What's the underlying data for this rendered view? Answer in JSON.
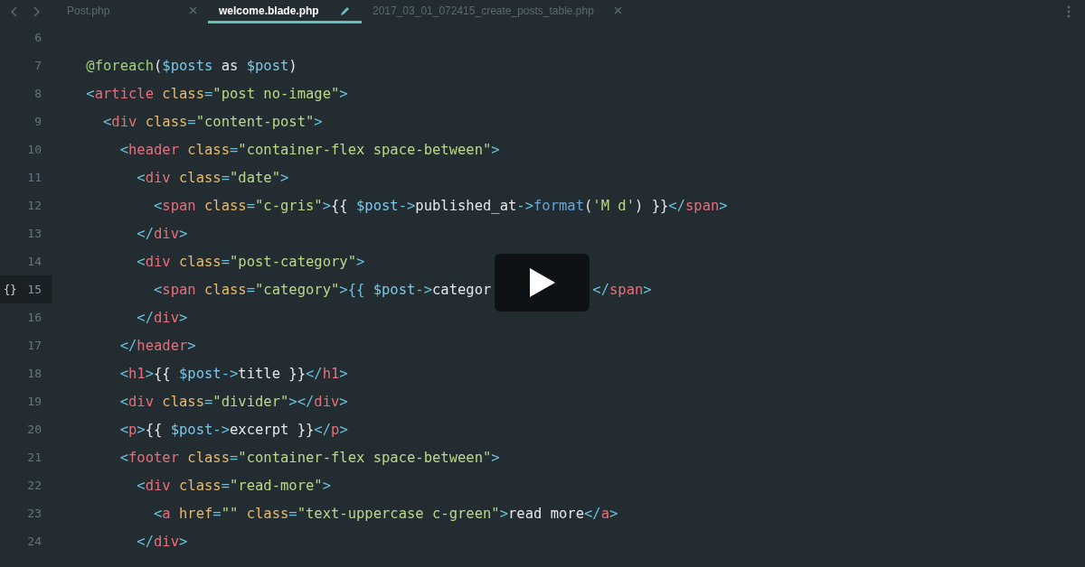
{
  "tabs": [
    {
      "label": "Post.php",
      "selected": false,
      "modified": false
    },
    {
      "label": "welcome.blade.php",
      "selected": true,
      "modified": true
    },
    {
      "label": "2017_03_01_072415_create_posts_table.php",
      "selected": false,
      "modified": false
    }
  ],
  "lines": [
    {
      "number": "6",
      "selected": false
    },
    {
      "number": "7",
      "selected": false,
      "tokens": [
        {
          "kind": "kw",
          "text": "    @foreach"
        },
        {
          "kind": "plain",
          "text": "("
        },
        {
          "kind": "var",
          "text": "$posts"
        },
        {
          "kind": "plain",
          "text": " as "
        },
        {
          "kind": "var",
          "text": "$post"
        },
        {
          "kind": "plain",
          "text": ")"
        }
      ]
    },
    {
      "number": "8",
      "selected": false,
      "tokens": [
        {
          "kind": "p",
          "text": "    <"
        },
        {
          "kind": "tag",
          "text": "article"
        },
        {
          "kind": "attr",
          "text": " class"
        },
        {
          "kind": "p",
          "text": "="
        },
        {
          "kind": "str",
          "text": "\"post no-image\""
        },
        {
          "kind": "p",
          "text": ">"
        }
      ]
    },
    {
      "number": "9",
      "selected": false,
      "tokens": [
        {
          "kind": "p",
          "text": "      <"
        },
        {
          "kind": "tag",
          "text": "div"
        },
        {
          "kind": "attr",
          "text": " class"
        },
        {
          "kind": "p",
          "text": "="
        },
        {
          "kind": "str",
          "text": "\"content-post\""
        },
        {
          "kind": "p",
          "text": ">"
        }
      ]
    },
    {
      "number": "10",
      "selected": false,
      "tokens": [
        {
          "kind": "p",
          "text": "        <"
        },
        {
          "kind": "tag",
          "text": "header"
        },
        {
          "kind": "attr",
          "text": " class"
        },
        {
          "kind": "p",
          "text": "="
        },
        {
          "kind": "str",
          "text": "\"container-flex space-between\""
        },
        {
          "kind": "p",
          "text": ">"
        }
      ]
    },
    {
      "number": "11",
      "selected": false,
      "tokens": [
        {
          "kind": "p",
          "text": "          <"
        },
        {
          "kind": "tag",
          "text": "div"
        },
        {
          "kind": "attr",
          "text": " class"
        },
        {
          "kind": "p",
          "text": "="
        },
        {
          "kind": "str",
          "text": "\"date\""
        },
        {
          "kind": "p",
          "text": ">"
        }
      ]
    },
    {
      "number": "12",
      "selected": false,
      "tokens": [
        {
          "kind": "p",
          "text": "            <"
        },
        {
          "kind": "tag",
          "text": "span"
        },
        {
          "kind": "attr",
          "text": " class"
        },
        {
          "kind": "p",
          "text": "="
        },
        {
          "kind": "str",
          "text": "\"c-gris\""
        },
        {
          "kind": "p",
          "text": ">"
        },
        {
          "kind": "plain",
          "text": "{{ "
        },
        {
          "kind": "var",
          "text": "$post"
        },
        {
          "kind": "p",
          "text": "->"
        },
        {
          "kind": "plain",
          "text": "published_at"
        },
        {
          "kind": "p",
          "text": "->"
        },
        {
          "kind": "func",
          "text": "format"
        },
        {
          "kind": "plain",
          "text": "("
        },
        {
          "kind": "str",
          "text": "'M d'"
        },
        {
          "kind": "plain",
          "text": ") }}"
        },
        {
          "kind": "p",
          "text": "</"
        },
        {
          "kind": "tag",
          "text": "span"
        },
        {
          "kind": "p",
          "text": ">"
        }
      ]
    },
    {
      "number": "13",
      "selected": false,
      "tokens": [
        {
          "kind": "p",
          "text": "          </"
        },
        {
          "kind": "tag",
          "text": "div"
        },
        {
          "kind": "p",
          "text": ">"
        }
      ]
    },
    {
      "number": "14",
      "selected": false,
      "tokens": [
        {
          "kind": "p",
          "text": "          <"
        },
        {
          "kind": "tag",
          "text": "div"
        },
        {
          "kind": "attr",
          "text": " class"
        },
        {
          "kind": "p",
          "text": "="
        },
        {
          "kind": "str",
          "text": "\"post-category\""
        },
        {
          "kind": "p",
          "text": ">"
        }
      ]
    },
    {
      "number": "15",
      "selected": true,
      "marker": "{}",
      "tokens": [
        {
          "kind": "p",
          "text": "            <"
        },
        {
          "kind": "tag",
          "text": "span"
        },
        {
          "kind": "attr",
          "text": " class"
        },
        {
          "kind": "p",
          "text": "="
        },
        {
          "kind": "str",
          "text": "\"category\""
        },
        {
          "kind": "p",
          "text": ">{{ "
        },
        {
          "kind": "var",
          "text": "$post"
        },
        {
          "kind": "p",
          "text": "->"
        },
        {
          "kind": "plain",
          "text": "categor"
        },
        {
          "kind": "covered"
        },
        {
          "kind": "p",
          "text": "</"
        },
        {
          "kind": "tag",
          "text": "span"
        },
        {
          "kind": "p",
          "text": ">"
        }
      ]
    },
    {
      "number": "16",
      "selected": false,
      "tokens": [
        {
          "kind": "p",
          "text": "          </"
        },
        {
          "kind": "tag",
          "text": "div"
        },
        {
          "kind": "p",
          "text": ">"
        }
      ]
    },
    {
      "number": "17",
      "selected": false,
      "tokens": [
        {
          "kind": "p",
          "text": "        </"
        },
        {
          "kind": "tag",
          "text": "header"
        },
        {
          "kind": "p",
          "text": ">"
        }
      ]
    },
    {
      "number": "18",
      "selected": false,
      "tokens": [
        {
          "kind": "p",
          "text": "        <"
        },
        {
          "kind": "tag",
          "text": "h1"
        },
        {
          "kind": "p",
          "text": ">"
        },
        {
          "kind": "plain",
          "text": "{{ "
        },
        {
          "kind": "var",
          "text": "$post"
        },
        {
          "kind": "p",
          "text": "->"
        },
        {
          "kind": "plain",
          "text": "title }}"
        },
        {
          "kind": "p",
          "text": "</"
        },
        {
          "kind": "tag",
          "text": "h1"
        },
        {
          "kind": "p",
          "text": ">"
        }
      ]
    },
    {
      "number": "19",
      "selected": false,
      "tokens": [
        {
          "kind": "p",
          "text": "        <"
        },
        {
          "kind": "tag",
          "text": "div"
        },
        {
          "kind": "attr",
          "text": " class"
        },
        {
          "kind": "p",
          "text": "="
        },
        {
          "kind": "str",
          "text": "\"divider\""
        },
        {
          "kind": "p",
          "text": "></"
        },
        {
          "kind": "tag",
          "text": "div"
        },
        {
          "kind": "p",
          "text": ">"
        }
      ]
    },
    {
      "number": "20",
      "selected": false,
      "tokens": [
        {
          "kind": "p",
          "text": "        <"
        },
        {
          "kind": "tag",
          "text": "p"
        },
        {
          "kind": "p",
          "text": ">"
        },
        {
          "kind": "plain",
          "text": "{{ "
        },
        {
          "kind": "var",
          "text": "$post"
        },
        {
          "kind": "p",
          "text": "->"
        },
        {
          "kind": "plain",
          "text": "excerpt }}"
        },
        {
          "kind": "p",
          "text": "</"
        },
        {
          "kind": "tag",
          "text": "p"
        },
        {
          "kind": "p",
          "text": ">"
        }
      ]
    },
    {
      "number": "21",
      "selected": false,
      "tokens": [
        {
          "kind": "p",
          "text": "        <"
        },
        {
          "kind": "tag",
          "text": "footer"
        },
        {
          "kind": "attr",
          "text": " class"
        },
        {
          "kind": "p",
          "text": "="
        },
        {
          "kind": "str",
          "text": "\"container-flex space-between\""
        },
        {
          "kind": "p",
          "text": ">"
        }
      ]
    },
    {
      "number": "22",
      "selected": false,
      "tokens": [
        {
          "kind": "p",
          "text": "          <"
        },
        {
          "kind": "tag",
          "text": "div"
        },
        {
          "kind": "attr",
          "text": " class"
        },
        {
          "kind": "p",
          "text": "="
        },
        {
          "kind": "str",
          "text": "\"read-more\""
        },
        {
          "kind": "p",
          "text": ">"
        }
      ]
    },
    {
      "number": "23",
      "selected": false,
      "tokens": [
        {
          "kind": "p",
          "text": "            <"
        },
        {
          "kind": "tag",
          "text": "a"
        },
        {
          "kind": "attr",
          "text": " href"
        },
        {
          "kind": "p",
          "text": "="
        },
        {
          "kind": "str",
          "text": "\"\""
        },
        {
          "kind": "attr",
          "text": " class"
        },
        {
          "kind": "p",
          "text": "="
        },
        {
          "kind": "str",
          "text": "\"text-uppercase c-green\""
        },
        {
          "kind": "p",
          "text": ">"
        },
        {
          "kind": "plain",
          "text": "read more"
        },
        {
          "kind": "p",
          "text": "</"
        },
        {
          "kind": "tag",
          "text": "a"
        },
        {
          "kind": "p",
          "text": ">"
        }
      ]
    },
    {
      "number": "24",
      "selected": false,
      "tokens": [
        {
          "kind": "p",
          "text": "          </"
        },
        {
          "kind": "tag",
          "text": "div"
        },
        {
          "kind": "p",
          "text": ">"
        }
      ]
    }
  ]
}
